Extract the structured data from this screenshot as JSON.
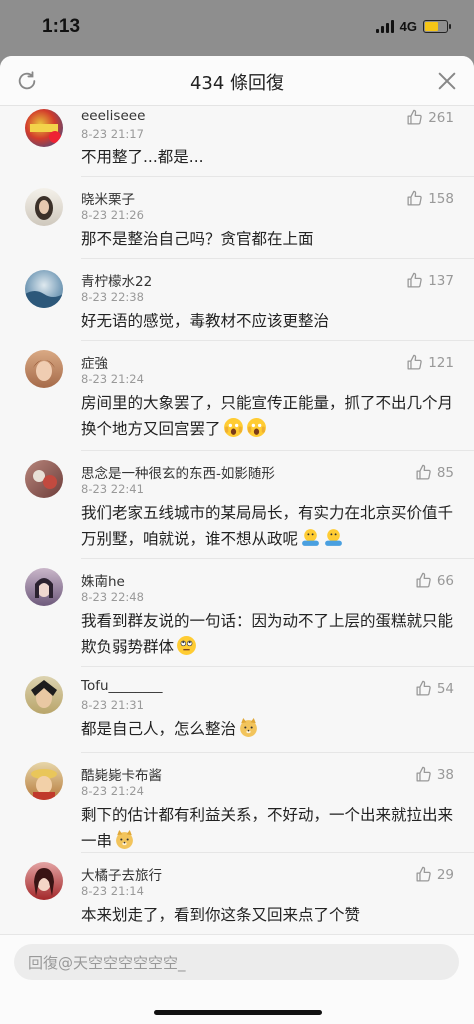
{
  "status_bar": {
    "time": "1:13",
    "network": "4G"
  },
  "header": {
    "title": "434 條回復"
  },
  "comments": [
    {
      "name": "eeeliseee",
      "time": "8-23 21:17",
      "text": "不用整了...都是...",
      "likes": "261"
    },
    {
      "name": "晓米栗子",
      "time": "8-23 21:26",
      "text": "那不是整治自己吗？贪官都在上面",
      "likes": "158"
    },
    {
      "name": "青柠檬水22",
      "time": "8-23 22:38",
      "text": "好无语的感觉，毒教材不应该更整治",
      "likes": "137"
    },
    {
      "name": "症強",
      "time": "8-23 21:24",
      "text": "房间里的大象罢了，只能宣传正能量，抓了不出几个月换个地方又回宫罢了",
      "likes": "121"
    },
    {
      "name": "思念是一种很玄的东西-如影随形",
      "time": "8-23 22:41",
      "text": "我们老家五线城市的某局局长，有实力在北京买价值千万别墅，咱就说，谁不想从政呢",
      "likes": "85"
    },
    {
      "name": "姝南he",
      "time": "8-23 22:48",
      "text": "我看到群友说的一句话：因为动不了上层的蛋糕就只能欺负弱势群体",
      "likes": "66"
    },
    {
      "name": "Tofu________",
      "time": "8-23 21:31",
      "text": "都是自己人，怎么整治",
      "likes": "54"
    },
    {
      "name": "酷毙毙卡布酱",
      "time": "8-23 21:24",
      "text": "剩下的估计都有利益关系，不好动，一个出来就拉出来一串",
      "likes": "38"
    },
    {
      "name": "大橘子去旅行",
      "time": "8-23 21:14",
      "text": "本来划走了，看到你这条又回来点了个赞",
      "likes": "29"
    }
  ],
  "reply_input": {
    "placeholder": "回復@天空空空空空空_"
  }
}
